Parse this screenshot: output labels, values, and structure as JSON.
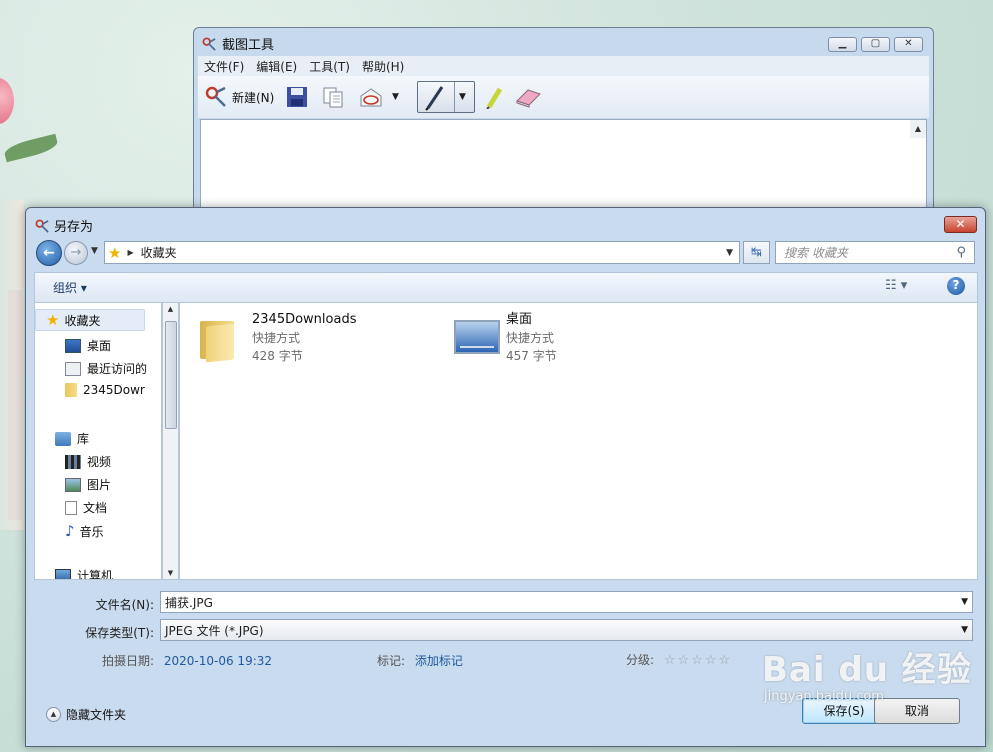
{
  "snipping_tool": {
    "title": "截图工具",
    "menu": [
      "文件(F)",
      "编辑(E)",
      "工具(T)",
      "帮助(H)"
    ],
    "new_label": "新建(N)"
  },
  "dialog": {
    "title": "另存为",
    "breadcrumb": "收藏夹",
    "search_placeholder": "搜索 收藏夹",
    "organize_label": "组织 ▾",
    "nav": {
      "favorites": "收藏夹",
      "favorites_items": [
        "桌面",
        "最近访问的",
        "2345Dowr"
      ],
      "libraries": "库",
      "library_items": [
        "视频",
        "图片",
        "文档",
        "音乐"
      ],
      "computer": "计算机"
    },
    "files": [
      {
        "name": "2345Downloads",
        "type": "快捷方式",
        "size": "428 字节"
      },
      {
        "name": "桌面",
        "type": "快捷方式",
        "size": "457 字节"
      }
    ],
    "filename_label": "文件名(N):",
    "filename_value": "捕获.JPG",
    "filetype_label": "保存类型(T):",
    "filetype_value": "JPEG 文件 (*.JPG)",
    "date_label": "拍摄日期:",
    "date_value": "2020-10-06 19:32",
    "tags_label": "标记:",
    "tags_value": "添加标记",
    "rating_label": "分级:",
    "rating_stars": "☆☆☆☆☆",
    "hide_folders": "隐藏文件夹",
    "save_button": "保存(S)",
    "cancel_button": "取消"
  },
  "watermark": {
    "brand": "Bai du 经验",
    "url": "jingyan.baidu.com"
  }
}
